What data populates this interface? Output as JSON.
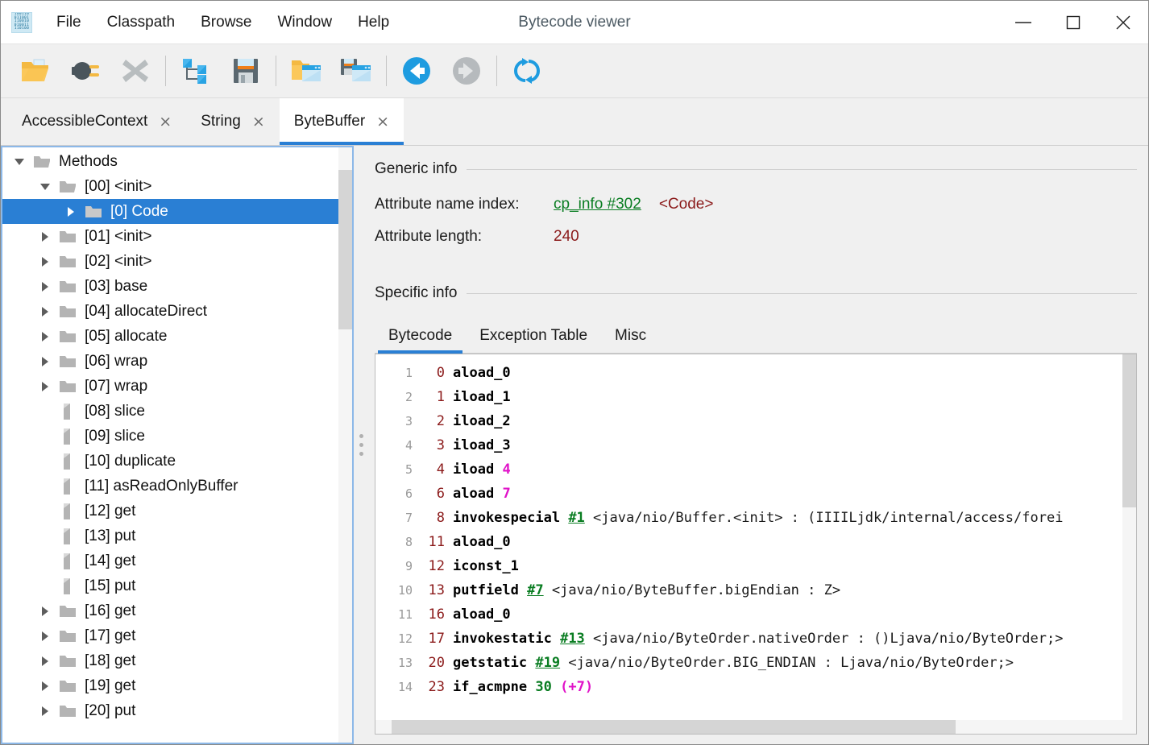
{
  "window": {
    "title": "Bytecode viewer",
    "app_icon": "binary-app-icon",
    "icon_rows": [
      "100110",
      "011001",
      "110010",
      "010011",
      "110100"
    ],
    "minimize_label": "minimize-icon",
    "maximize_label": "maximize-icon",
    "close_label": "close-icon"
  },
  "menu": {
    "items": [
      {
        "label": "File",
        "name": "menu-file"
      },
      {
        "label": "Classpath",
        "name": "menu-classpath"
      },
      {
        "label": "Browse",
        "name": "menu-browse"
      },
      {
        "label": "Window",
        "name": "menu-window"
      },
      {
        "label": "Help",
        "name": "menu-help"
      }
    ]
  },
  "toolbar": {
    "buttons": [
      {
        "icon": "open-file-icon",
        "title": "Open class file"
      },
      {
        "icon": "plug-icon",
        "title": "Open from classpath"
      },
      {
        "icon": "close-x-icon",
        "title": "Close"
      },
      {
        "sep": true
      },
      {
        "icon": "tree-structure-icon",
        "title": "Show tree"
      },
      {
        "icon": "save-floppy-icon",
        "title": "Save"
      },
      {
        "sep": true
      },
      {
        "icon": "open-window-icon",
        "title": "Open in new window"
      },
      {
        "icon": "save-window-icon",
        "title": "Save window"
      },
      {
        "sep": true
      },
      {
        "icon": "back-arrow-icon",
        "title": "Back"
      },
      {
        "icon": "forward-arrow-icon",
        "title": "Forward"
      },
      {
        "sep": true
      },
      {
        "icon": "reload-icon",
        "title": "Reload"
      }
    ]
  },
  "class_tabs": {
    "items": [
      {
        "label": "AccessibleContext",
        "active": false,
        "close": "×"
      },
      {
        "label": "String",
        "active": false,
        "close": "×"
      },
      {
        "label": "ByteBuffer",
        "active": true,
        "close": "×"
      }
    ]
  },
  "tree": {
    "nodes": [
      {
        "label": "Methods",
        "depth": 0,
        "state": "expanded",
        "icon": "folder-open-icon",
        "selected": false
      },
      {
        "label": "[00] <init>",
        "depth": 1,
        "state": "expanded",
        "icon": "folder-open-icon",
        "selected": false
      },
      {
        "label": "[0] Code",
        "depth": 2,
        "state": "collapsed",
        "icon": "folder-icon",
        "selected": true
      },
      {
        "label": "[01] <init>",
        "depth": 1,
        "state": "collapsed",
        "icon": "folder-icon",
        "selected": false
      },
      {
        "label": "[02] <init>",
        "depth": 1,
        "state": "collapsed",
        "icon": "folder-icon",
        "selected": false
      },
      {
        "label": "[03] base",
        "depth": 1,
        "state": "collapsed",
        "icon": "folder-icon",
        "selected": false
      },
      {
        "label": "[04] allocateDirect",
        "depth": 1,
        "state": "collapsed",
        "icon": "folder-icon",
        "selected": false
      },
      {
        "label": "[05] allocate",
        "depth": 1,
        "state": "collapsed",
        "icon": "folder-icon",
        "selected": false
      },
      {
        "label": "[06] wrap",
        "depth": 1,
        "state": "collapsed",
        "icon": "folder-icon",
        "selected": false
      },
      {
        "label": "[07] wrap",
        "depth": 1,
        "state": "collapsed",
        "icon": "folder-icon",
        "selected": false
      },
      {
        "label": "[08] slice",
        "depth": 1,
        "state": "leaf",
        "icon": "document-icon",
        "selected": false
      },
      {
        "label": "[09] slice",
        "depth": 1,
        "state": "leaf",
        "icon": "document-icon",
        "selected": false
      },
      {
        "label": "[10] duplicate",
        "depth": 1,
        "state": "leaf",
        "icon": "document-icon",
        "selected": false
      },
      {
        "label": "[11] asReadOnlyBuffer",
        "depth": 1,
        "state": "leaf",
        "icon": "document-icon",
        "selected": false
      },
      {
        "label": "[12] get",
        "depth": 1,
        "state": "leaf",
        "icon": "document-icon",
        "selected": false
      },
      {
        "label": "[13] put",
        "depth": 1,
        "state": "leaf",
        "icon": "document-icon",
        "selected": false
      },
      {
        "label": "[14] get",
        "depth": 1,
        "state": "leaf",
        "icon": "document-icon",
        "selected": false
      },
      {
        "label": "[15] put",
        "depth": 1,
        "state": "leaf",
        "icon": "document-icon",
        "selected": false
      },
      {
        "label": "[16] get",
        "depth": 1,
        "state": "collapsed",
        "icon": "folder-icon",
        "selected": false
      },
      {
        "label": "[17] get",
        "depth": 1,
        "state": "collapsed",
        "icon": "folder-icon",
        "selected": false
      },
      {
        "label": "[18] get",
        "depth": 1,
        "state": "collapsed",
        "icon": "folder-icon",
        "selected": false
      },
      {
        "label": "[19] get",
        "depth": 1,
        "state": "collapsed",
        "icon": "folder-icon",
        "selected": false
      },
      {
        "label": "[20] put",
        "depth": 1,
        "state": "collapsed",
        "icon": "folder-icon",
        "selected": false
      }
    ]
  },
  "detail": {
    "generic_info_label": "Generic info",
    "specific_info_label": "Specific info",
    "rows": [
      {
        "key": "Attribute name index:",
        "link": "cp_info #302",
        "desc": "<Code>"
      },
      {
        "key": "Attribute length:",
        "num": "240"
      }
    ],
    "inner_tabs": [
      {
        "label": "Bytecode",
        "active": true
      },
      {
        "label": "Exception Table",
        "active": false
      },
      {
        "label": "Misc",
        "active": false
      }
    ]
  },
  "bytecode": {
    "lines": [
      {
        "n": "1",
        "offset": "0",
        "op": "aload_0",
        "cp": "",
        "sig": "",
        "imm": "",
        "branch": ""
      },
      {
        "n": "2",
        "offset": "1",
        "op": "iload_1",
        "cp": "",
        "sig": "",
        "imm": "",
        "branch": ""
      },
      {
        "n": "3",
        "offset": "2",
        "op": "iload_2",
        "cp": "",
        "sig": "",
        "imm": "",
        "branch": ""
      },
      {
        "n": "4",
        "offset": "3",
        "op": "iload_3",
        "cp": "",
        "sig": "",
        "imm": "",
        "branch": ""
      },
      {
        "n": "5",
        "offset": "4",
        "op": "iload",
        "cp": "",
        "sig": "",
        "imm": "4",
        "branch": ""
      },
      {
        "n": "6",
        "offset": "6",
        "op": "aload",
        "cp": "",
        "sig": "",
        "imm": "7",
        "branch": ""
      },
      {
        "n": "7",
        "offset": "8",
        "op": "invokespecial",
        "cp": "#1",
        "sig": "<java/nio/Buffer.<init> : (IIIILjdk/internal/access/forei",
        "imm": "",
        "branch": ""
      },
      {
        "n": "8",
        "offset": "11",
        "op": "aload_0",
        "cp": "",
        "sig": "",
        "imm": "",
        "branch": ""
      },
      {
        "n": "9",
        "offset": "12",
        "op": "iconst_1",
        "cp": "",
        "sig": "",
        "imm": "",
        "branch": ""
      },
      {
        "n": "10",
        "offset": "13",
        "op": "putfield",
        "cp": "#7",
        "sig": "<java/nio/ByteBuffer.bigEndian : Z>",
        "imm": "",
        "branch": ""
      },
      {
        "n": "11",
        "offset": "16",
        "op": "aload_0",
        "cp": "",
        "sig": "",
        "imm": "",
        "branch": ""
      },
      {
        "n": "12",
        "offset": "17",
        "op": "invokestatic",
        "cp": "#13",
        "sig": "<java/nio/ByteOrder.nativeOrder : ()Ljava/nio/ByteOrder;>",
        "imm": "",
        "branch": ""
      },
      {
        "n": "13",
        "offset": "20",
        "op": "getstatic",
        "cp": "#19",
        "sig": "<java/nio/ByteOrder.BIG_ENDIAN : Ljava/nio/ByteOrder;>",
        "imm": "",
        "branch": ""
      },
      {
        "n": "14",
        "offset": "23",
        "op": "if_acmpne",
        "cp": "",
        "sig": "",
        "imm": "",
        "branch": "30   (+7)"
      }
    ]
  },
  "colors": {
    "accent": "#2a7fd4",
    "selection": "#2a7fd4",
    "link_green": "#0a7d22",
    "value_red": "#8b1a1a",
    "immediate_magenta": "#e012c8"
  }
}
